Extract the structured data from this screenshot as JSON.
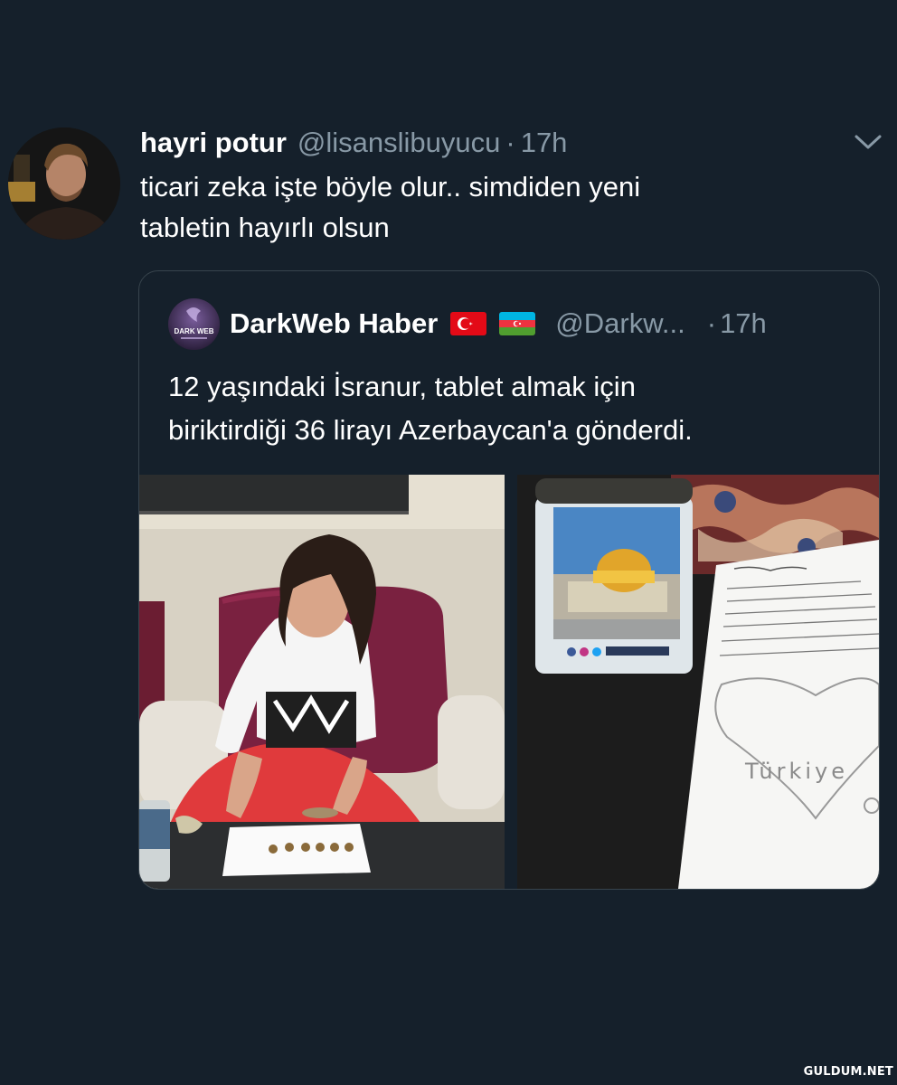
{
  "tweet": {
    "author_name": "hayri potur",
    "author_handle": "@lisanslibuyucu",
    "separator": "·",
    "time": "17h",
    "text_lines": [
      "ticari zeka işte böyle olur.. simdiden yeni",
      "tabletin hayırlı olsun"
    ],
    "menu_icon": "chevron-down-icon"
  },
  "quoted_tweet": {
    "author_name": "DarkWeb Haber",
    "flags": [
      "turkey-flag-icon",
      "azerbaijan-flag-icon"
    ],
    "author_handle": "@Darkw...",
    "separator": "·",
    "time": "17h",
    "avatar_text": "DARK WEB",
    "text_lines": [
      "12 yaşındaki İsranur, tablet almak için",
      "biriktirdiği 36 lirayı Azerbaycan'a gönderdi."
    ],
    "media": [
      {
        "name": "girl-counting-coins-photo"
      },
      {
        "name": "coin-box-and-letter-photo",
        "letter_text": "Türkiye"
      }
    ]
  },
  "watermark": "GULDUM.NET",
  "colors": {
    "background": "#15202b",
    "text": "#ffffff",
    "secondary": "#8899a6",
    "border": "#38444d"
  }
}
